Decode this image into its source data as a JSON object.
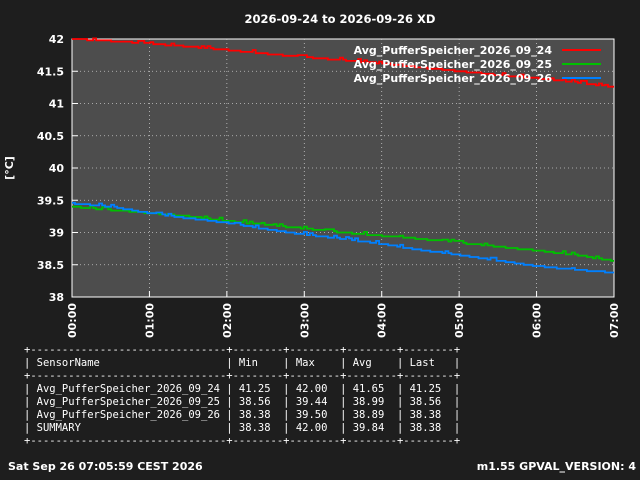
{
  "chart_data": {
    "type": "line",
    "title": "2026-09-24 to 2026-09-26 XD",
    "ylabel": "[°C]",
    "xlabel": "",
    "ylim": [
      38,
      42
    ],
    "yticks": [
      "38",
      "38.5",
      "39",
      "39.5",
      "40",
      "40.5",
      "41",
      "41.5",
      "42"
    ],
    "xlim_hours": [
      0,
      7
    ],
    "xticks": [
      "00:00",
      "01:00",
      "02:00",
      "03:00",
      "04:00",
      "05:00",
      "06:00",
      "07:00"
    ],
    "grid": true,
    "legend_position": "top-right",
    "x_hours": [
      0,
      0.5,
      1,
      1.5,
      2,
      2.5,
      3,
      3.5,
      4,
      4.5,
      5,
      5.5,
      6,
      6.5,
      7
    ],
    "series": [
      {
        "name": "Avg_PufferSpeicher_2026_09_24",
        "color": "#ff0000",
        "values": [
          42.0,
          41.97,
          41.93,
          41.88,
          41.83,
          41.77,
          41.72,
          41.67,
          41.62,
          41.56,
          41.5,
          41.44,
          41.39,
          41.33,
          41.25
        ]
      },
      {
        "name": "Avg_PufferSpeicher_2026_09_25",
        "color": "#00c000",
        "values": [
          39.4,
          39.35,
          39.3,
          39.25,
          39.18,
          39.12,
          39.06,
          39.0,
          38.95,
          38.9,
          38.84,
          38.78,
          38.72,
          38.65,
          38.56
        ]
      },
      {
        "name": "Avg_PufferSpeicher_2026_09_26",
        "color": "#0080ff",
        "values": [
          39.45,
          39.4,
          39.3,
          39.22,
          39.15,
          39.05,
          38.97,
          38.9,
          38.82,
          38.73,
          38.65,
          38.56,
          38.48,
          38.42,
          38.38
        ]
      }
    ]
  },
  "stats": {
    "border": "+-------------------------------+--------+--------+--------+--------+",
    "header": "| SensorName                    | Min    | Max    | Avg    | Last   |",
    "rows": [
      "| Avg_PufferSpeicher_2026_09_24 | 41.25  | 42.00  | 41.65  | 41.25  |",
      "| Avg_PufferSpeicher_2026_09_25 | 38.56  | 39.44  | 38.99  | 38.56  |",
      "| Avg_PufferSpeicher_2026_09_26 | 38.38  | 39.50  | 38.89  | 38.38  |",
      "| SUMMARY                       | 38.38  | 42.00  | 39.84  | 38.38  |"
    ]
  },
  "footer": {
    "timestamp": "Sat Sep 26 07:05:59 CEST 2026",
    "version": "m1.55 GPVAL_VERSION: 4"
  }
}
